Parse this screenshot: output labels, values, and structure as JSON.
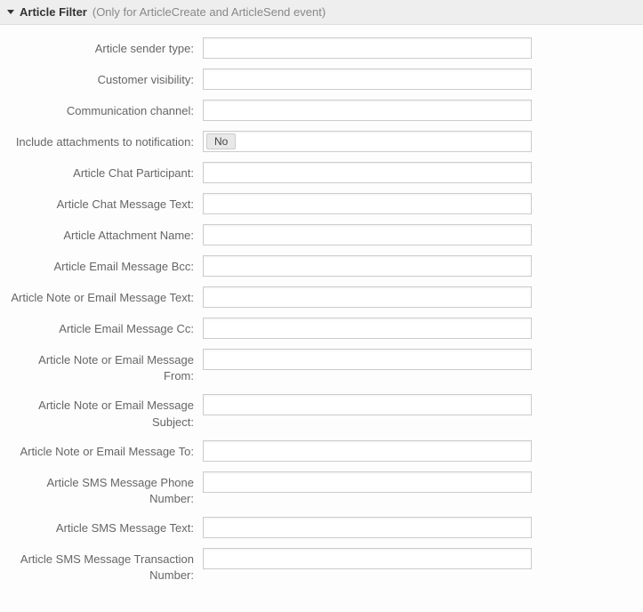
{
  "header": {
    "title": "Article Filter",
    "subtitle": "(Only for ArticleCreate and ArticleSend event)"
  },
  "fields": {
    "article_sender_type": {
      "label": "Article sender type:",
      "value": ""
    },
    "customer_visibility": {
      "label": "Customer visibility:",
      "value": ""
    },
    "communication_channel": {
      "label": "Communication channel:",
      "value": ""
    },
    "include_attachments": {
      "label": "Include attachments to notification:",
      "tag": "No"
    },
    "chat_participant": {
      "label": "Article Chat Participant:",
      "value": ""
    },
    "chat_message_text": {
      "label": "Article Chat Message Text:",
      "value": ""
    },
    "attachment_name": {
      "label": "Article Attachment Name:",
      "value": ""
    },
    "email_bcc": {
      "label": "Article Email Message Bcc:",
      "value": ""
    },
    "note_email_text": {
      "label": "Article Note or Email Message Text:",
      "value": ""
    },
    "email_cc": {
      "label": "Article Email Message Cc:",
      "value": ""
    },
    "note_email_from": {
      "label": "Article Note or Email Message From:",
      "value": ""
    },
    "note_email_subject": {
      "label": "Article Note or Email Message Subject:",
      "value": ""
    },
    "note_email_to": {
      "label": "Article Note or Email Message To:",
      "value": ""
    },
    "sms_phone": {
      "label": "Article SMS Message Phone Number:",
      "value": ""
    },
    "sms_text": {
      "label": "Article SMS Message Text:",
      "value": ""
    },
    "sms_transaction": {
      "label": "Article SMS Message Transaction Number:",
      "value": ""
    }
  }
}
